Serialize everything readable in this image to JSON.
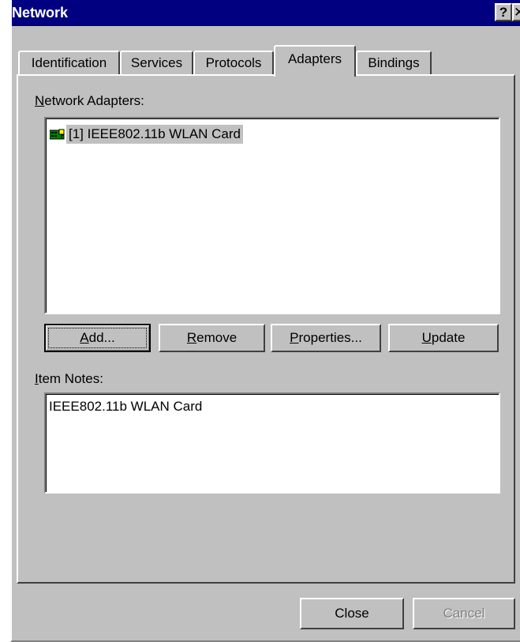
{
  "window": {
    "title": "Network",
    "help_glyph": "?",
    "close_glyph": "✕"
  },
  "tabs": [
    {
      "label": "Identification",
      "active": false
    },
    {
      "label": "Services",
      "active": false
    },
    {
      "label": "Protocols",
      "active": false
    },
    {
      "label": "Adapters",
      "active": true
    },
    {
      "label": "Bindings",
      "active": false
    }
  ],
  "adapters": {
    "label_accel": "N",
    "label_rest": "etwork Adapters:",
    "items": [
      {
        "label": "[1] IEEE802.11b WLAN Card",
        "icon": "network-card-icon",
        "selected": true
      }
    ]
  },
  "buttons": {
    "add": {
      "accel": "A",
      "rest": "dd..."
    },
    "remove": {
      "accel": "R",
      "rest": "emove"
    },
    "properties": {
      "accel": "P",
      "rest": "roperties..."
    },
    "update": {
      "accel": "U",
      "rest": "pdate"
    }
  },
  "notes": {
    "label_accel": "I",
    "label_rest": "tem Notes:",
    "text": "IEEE802.11b WLAN Card"
  },
  "footer": {
    "close_label": "Close",
    "cancel_label": "Cancel"
  },
  "colors": {
    "titlebar": "#000080",
    "face": "#c0c0c0",
    "selection": "#c0c0c0"
  }
}
